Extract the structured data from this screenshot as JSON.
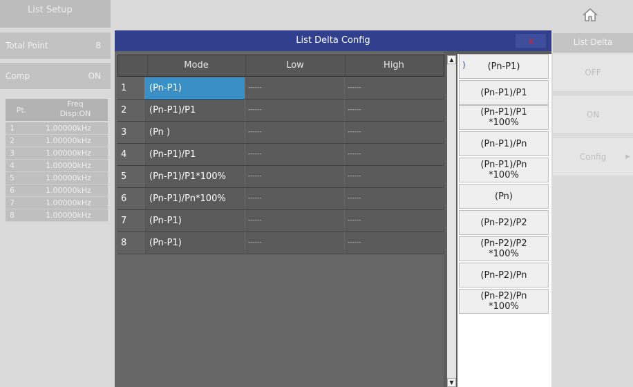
{
  "background": {
    "title": "List Setup",
    "total_point": {
      "label": "Total Point",
      "value": "8"
    },
    "comp": {
      "label": "Comp",
      "value": "ON"
    },
    "list_header": {
      "col1": "Pt.",
      "col2_line1": "Freq",
      "col2_line2": "Disp:ON"
    },
    "list_rows": [
      {
        "n": "1",
        "freq": "1.00000kHz"
      },
      {
        "n": "2",
        "freq": "1.00000kHz"
      },
      {
        "n": "3",
        "freq": "1.00000kHz"
      },
      {
        "n": "4",
        "freq": "1.00000kHz"
      },
      {
        "n": "5",
        "freq": "1.00000kHz"
      },
      {
        "n": "6",
        "freq": "1.00000kHz"
      },
      {
        "n": "7",
        "freq": "1.00000kHz"
      },
      {
        "n": "8",
        "freq": "1.00000kHz"
      }
    ],
    "right_header": "List Delta",
    "right_buttons": [
      "OFF",
      "ON",
      "Config"
    ]
  },
  "dialog": {
    "title": "List Delta Config",
    "close_label": "x",
    "columns": [
      "Mode",
      "Low",
      "High"
    ],
    "rows": [
      {
        "index": "1",
        "mode": "(Pn-P1)",
        "low": "------",
        "high": "------",
        "selected": true
      },
      {
        "index": "2",
        "mode": "(Pn-P1)/P1",
        "low": "------",
        "high": "------",
        "selected": false
      },
      {
        "index": "3",
        "mode": "(Pn    )",
        "low": "------",
        "high": "------",
        "selected": false
      },
      {
        "index": "4",
        "mode": "(Pn-P1)/P1",
        "low": "------",
        "high": "------",
        "selected": false
      },
      {
        "index": "5",
        "mode": "(Pn-P1)/P1*100%",
        "low": "------",
        "high": "------",
        "selected": false
      },
      {
        "index": "6",
        "mode": "(Pn-P1)/Pn*100%",
        "low": "------",
        "high": "------",
        "selected": false
      },
      {
        "index": "7",
        "mode": "(Pn-P1)",
        "low": "------",
        "high": "------",
        "selected": false
      },
      {
        "index": "8",
        "mode": "(Pn-P1)",
        "low": "------",
        "high": "------",
        "selected": false
      }
    ],
    "options": [
      {
        "l1": "(Pn-P1)",
        "l2": ""
      },
      {
        "l1": "(Pn-P1)/P1",
        "l2": ""
      },
      {
        "l1": "(Pn-P1)/P1",
        "l2": "*100%"
      },
      {
        "l1": "(Pn-P1)/Pn",
        "l2": ""
      },
      {
        "l1": "(Pn-P1)/Pn",
        "l2": "*100%"
      },
      {
        "l1": "(Pn)",
        "l2": ""
      },
      {
        "l1": "(Pn-P2)/P2",
        "l2": ""
      },
      {
        "l1": "(Pn-P2)/P2",
        "l2": "*100%"
      },
      {
        "l1": "(Pn-P2)/Pn",
        "l2": ""
      },
      {
        "l1": "(Pn-P2)/Pn",
        "l2": "*100%"
      }
    ],
    "selected_option_marker": ")"
  },
  "colors": {
    "dialog_title_bar": "#313f8c",
    "selected_cell": "#3a8fc6",
    "close_x": "#e02020"
  }
}
